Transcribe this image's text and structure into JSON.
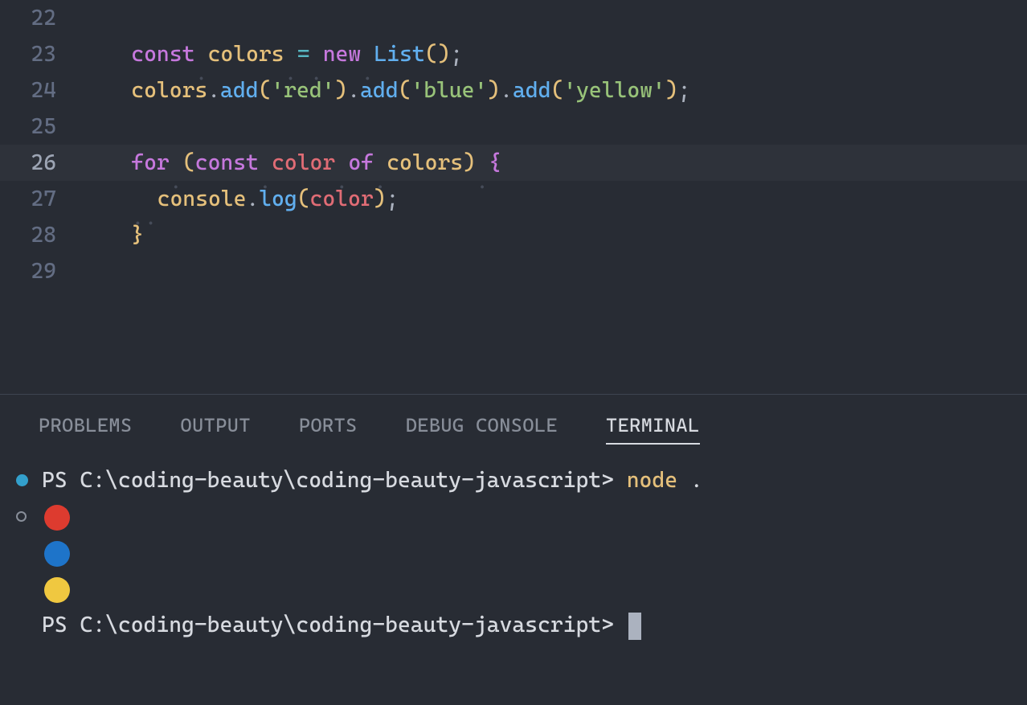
{
  "editor": {
    "lines": [
      {
        "num": "22",
        "tokens": []
      },
      {
        "num": "23",
        "tokens": [
          {
            "cls": "tk-keyword",
            "t": "const"
          },
          {
            "cls": "ws-dot",
            "t": "·"
          },
          {
            "cls": "tk-var",
            "t": "colors"
          },
          {
            "cls": "ws-dot",
            "t": "·"
          },
          {
            "cls": "tk-operator",
            "t": "="
          },
          {
            "cls": "ws-dot",
            "t": "·"
          },
          {
            "cls": "tk-new",
            "t": "new"
          },
          {
            "cls": "ws-dot",
            "t": "·"
          },
          {
            "cls": "tk-class",
            "t": "List"
          },
          {
            "cls": "tk-bracket-yellow",
            "t": "()"
          },
          {
            "cls": "tk-punct",
            "t": ";"
          }
        ]
      },
      {
        "num": "24",
        "tokens": [
          {
            "cls": "tk-var",
            "t": "colors"
          },
          {
            "cls": "tk-punct",
            "t": "."
          },
          {
            "cls": "tk-method",
            "t": "add"
          },
          {
            "cls": "tk-bracket-yellow",
            "t": "("
          },
          {
            "cls": "tk-string",
            "t": "'red'"
          },
          {
            "cls": "tk-bracket-yellow",
            "t": ")"
          },
          {
            "cls": "tk-punct",
            "t": "."
          },
          {
            "cls": "tk-method",
            "t": "add"
          },
          {
            "cls": "tk-bracket-yellow",
            "t": "("
          },
          {
            "cls": "tk-string",
            "t": "'blue'"
          },
          {
            "cls": "tk-bracket-yellow",
            "t": ")"
          },
          {
            "cls": "tk-punct",
            "t": "."
          },
          {
            "cls": "tk-method",
            "t": "add"
          },
          {
            "cls": "tk-bracket-yellow",
            "t": "("
          },
          {
            "cls": "tk-string",
            "t": "'yellow'"
          },
          {
            "cls": "tk-bracket-yellow",
            "t": ")"
          },
          {
            "cls": "tk-punct",
            "t": ";"
          }
        ]
      },
      {
        "num": "25",
        "tokens": []
      },
      {
        "num": "26",
        "current": true,
        "tokens": [
          {
            "cls": "tk-keyword",
            "t": "for"
          },
          {
            "cls": "ws-dot",
            "t": "·"
          },
          {
            "cls": "tk-bracket-yellow",
            "t": "("
          },
          {
            "cls": "tk-keyword",
            "t": "const"
          },
          {
            "cls": "ws-dot",
            "t": "·"
          },
          {
            "cls": "tk-varname",
            "t": "color"
          },
          {
            "cls": "ws-dot",
            "t": "·"
          },
          {
            "cls": "tk-keyword",
            "t": "of"
          },
          {
            "cls": "ws-dot",
            "t": "·"
          },
          {
            "cls": "tk-var",
            "t": "colors"
          },
          {
            "cls": "tk-bracket-yellow",
            "t": ")"
          },
          {
            "cls": "ws-dot",
            "t": "·"
          },
          {
            "cls": "tk-bracket-purple",
            "t": "{"
          }
        ]
      },
      {
        "num": "27",
        "tokens": [
          {
            "cls": "ws-dot",
            "t": "·"
          },
          {
            "cls": "ws-dot",
            "t": "·"
          },
          {
            "cls": "tk-obj",
            "t": "console"
          },
          {
            "cls": "tk-punct",
            "t": "."
          },
          {
            "cls": "tk-method",
            "t": "log"
          },
          {
            "cls": "tk-bracket-yellow",
            "t": "("
          },
          {
            "cls": "tk-varname",
            "t": "color"
          },
          {
            "cls": "tk-bracket-yellow",
            "t": ")"
          },
          {
            "cls": "tk-punct",
            "t": ";"
          }
        ]
      },
      {
        "num": "28",
        "tokens": [
          {
            "cls": "tk-bracket-yellow",
            "t": "}"
          }
        ]
      },
      {
        "num": "29",
        "tokens": []
      }
    ],
    "indent_cols": 4
  },
  "panel": {
    "tabs": [
      {
        "label": "PROBLEMS",
        "active": false
      },
      {
        "label": "OUTPUT",
        "active": false
      },
      {
        "label": "PORTS",
        "active": false
      },
      {
        "label": "DEBUG CONSOLE",
        "active": false
      },
      {
        "label": "TERMINAL",
        "active": true
      }
    ]
  },
  "terminal": {
    "lines": [
      {
        "marker": "filled",
        "segments": [
          {
            "cls": "term-prompt",
            "t": "PS C:\\coding-beauty\\coding-beauty-javascript> "
          },
          {
            "cls": "term-cmd-yellow",
            "t": "node "
          },
          {
            "cls": "term-prompt",
            "t": "."
          }
        ]
      },
      {
        "marker": "hollow",
        "emoji": "red"
      },
      {
        "marker": "",
        "emoji": "blue"
      },
      {
        "marker": "",
        "emoji": "yellow"
      },
      {
        "marker": "",
        "segments": [
          {
            "cls": "term-prompt",
            "t": "PS C:\\coding-beauty\\coding-beauty-javascript> "
          }
        ],
        "cursor": true
      }
    ],
    "emoji_colors": {
      "red": "#dd3b2f",
      "blue": "#1e74c9",
      "yellow": "#f0c840"
    }
  }
}
